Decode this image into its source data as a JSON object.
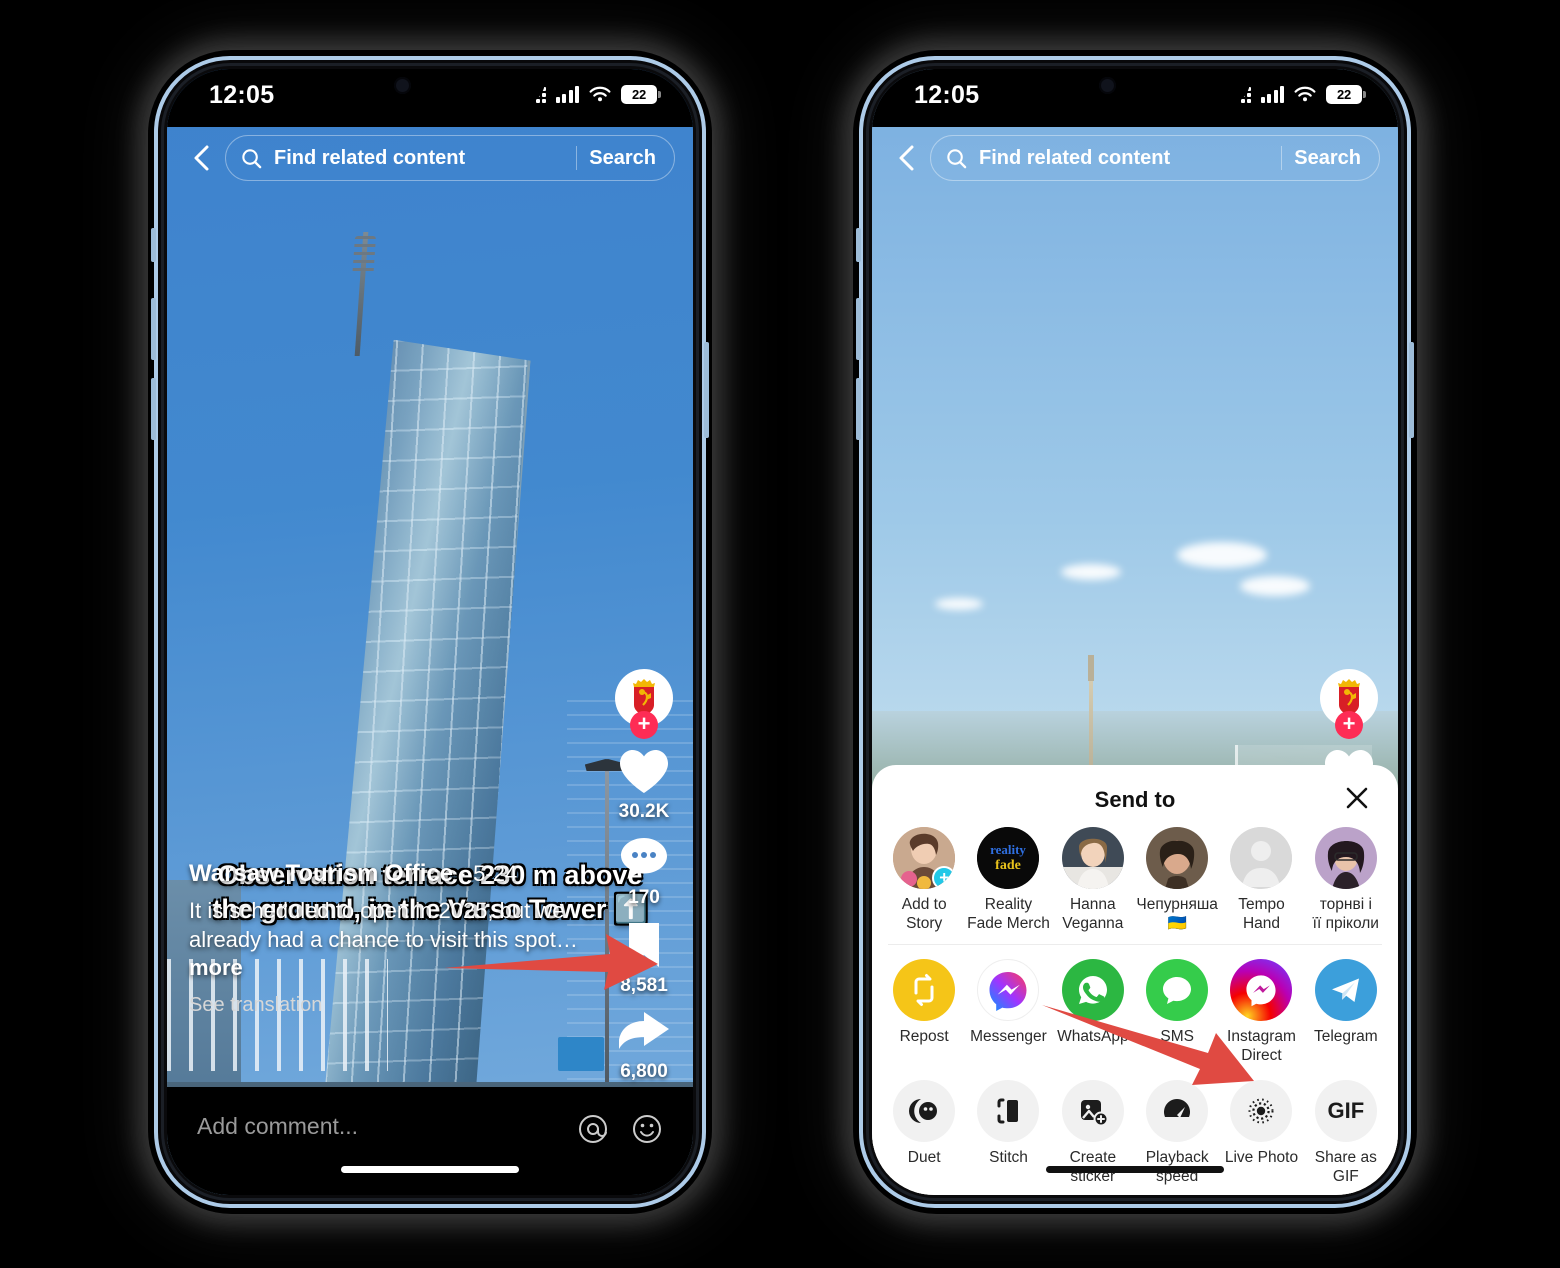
{
  "colors": {
    "accent_red": "#fe2c55",
    "arrow_red": "#e04a42",
    "bezel": "#adcbe8",
    "sheet_bg": "#ffffff"
  },
  "status_bar": {
    "time": "12:05",
    "battery": "22",
    "wifi_icon": "wifi-icon",
    "signal_icon": "cellular-signal-icon"
  },
  "search_header": {
    "back_icon": "back-chevron-icon",
    "search_icon": "search-icon",
    "placeholder": "Find related content",
    "button_label": "Search"
  },
  "phone1": {
    "caption_line1": "Observation terrace 230 m above",
    "caption_line2": "the ground, in the Varso Tower",
    "caption_emoji": "⬆️",
    "author": "Warsaw Tourism Office",
    "date": "· 5-24",
    "description": "It is scheduled to open in 2025, but we already had a chance to visit this spot…",
    "more_label": " more",
    "translation_label": "See translation",
    "comment_placeholder": "Add comment...",
    "mention_icon": "at-mention-icon",
    "emoji_icon": "emoji-smiley-icon",
    "actions": [
      {
        "icon": "profile-avatar-warsaw-crest",
        "count": ""
      },
      {
        "icon": "heart-like-icon",
        "count": "30.2K"
      },
      {
        "icon": "comment-bubble-icon",
        "count": "170"
      },
      {
        "icon": "bookmark-save-icon",
        "count": "8,581"
      },
      {
        "icon": "share-arrow-icon",
        "count": "6,800"
      },
      {
        "icon": "music-disc-r4r-icon",
        "count": ""
      }
    ]
  },
  "phone2": {
    "actions": [
      {
        "icon": "profile-avatar-warsaw-crest",
        "count": ""
      },
      {
        "icon": "heart-like-icon",
        "count": ""
      }
    ],
    "sheet": {
      "title": "Send to",
      "close_icon": "close-x-icon",
      "contacts": [
        {
          "name_line1": "Add to",
          "name_line2": "Story",
          "icon": "add-to-story-avatar",
          "badge": "plus-badge"
        },
        {
          "name_line1": "Reality",
          "name_line2": "Fade Merch",
          "icon": "contact-avatar-reality-fade-merch"
        },
        {
          "name_line1": "Hanna",
          "name_line2": "Veganna",
          "icon": "contact-avatar-hanna-veganna"
        },
        {
          "name_line1": "Чепурняша",
          "name_line2": "🇺🇦",
          "icon": "contact-avatar-chepurnyasha"
        },
        {
          "name_line1": "Tempo",
          "name_line2": "Hand",
          "icon": "contact-avatar-placeholder"
        },
        {
          "name_line1": "торнві і",
          "name_line2": "її пріколи",
          "icon": "contact-avatar-tornvi"
        }
      ],
      "apps": [
        {
          "label": "Repost",
          "icon": "repost-icon"
        },
        {
          "label": "Messenger",
          "icon": "messenger-icon"
        },
        {
          "label": "WhatsApp",
          "icon": "whatsapp-icon"
        },
        {
          "label": "SMS",
          "icon": "sms-icon"
        },
        {
          "label": "Instagram Direct",
          "icon": "instagram-direct-icon"
        },
        {
          "label": "Telegram",
          "icon": "telegram-icon"
        }
      ],
      "tools": [
        {
          "label": "Duet",
          "icon": "duet-icon"
        },
        {
          "label": "Stitch",
          "icon": "stitch-icon"
        },
        {
          "label": "Create sticker",
          "icon": "create-sticker-icon"
        },
        {
          "label": "Playback speed",
          "icon": "playback-speed-icon"
        },
        {
          "label": "Live Photo",
          "icon": "live-photo-icon"
        },
        {
          "label": "Share as GIF",
          "icon": "share-as-gif-icon"
        }
      ]
    }
  },
  "annotations": [
    {
      "name": "arrow-to-share-button",
      "target": "share-arrow-icon"
    },
    {
      "name": "arrow-to-live-photo",
      "target": "live-photo-icon"
    }
  ]
}
